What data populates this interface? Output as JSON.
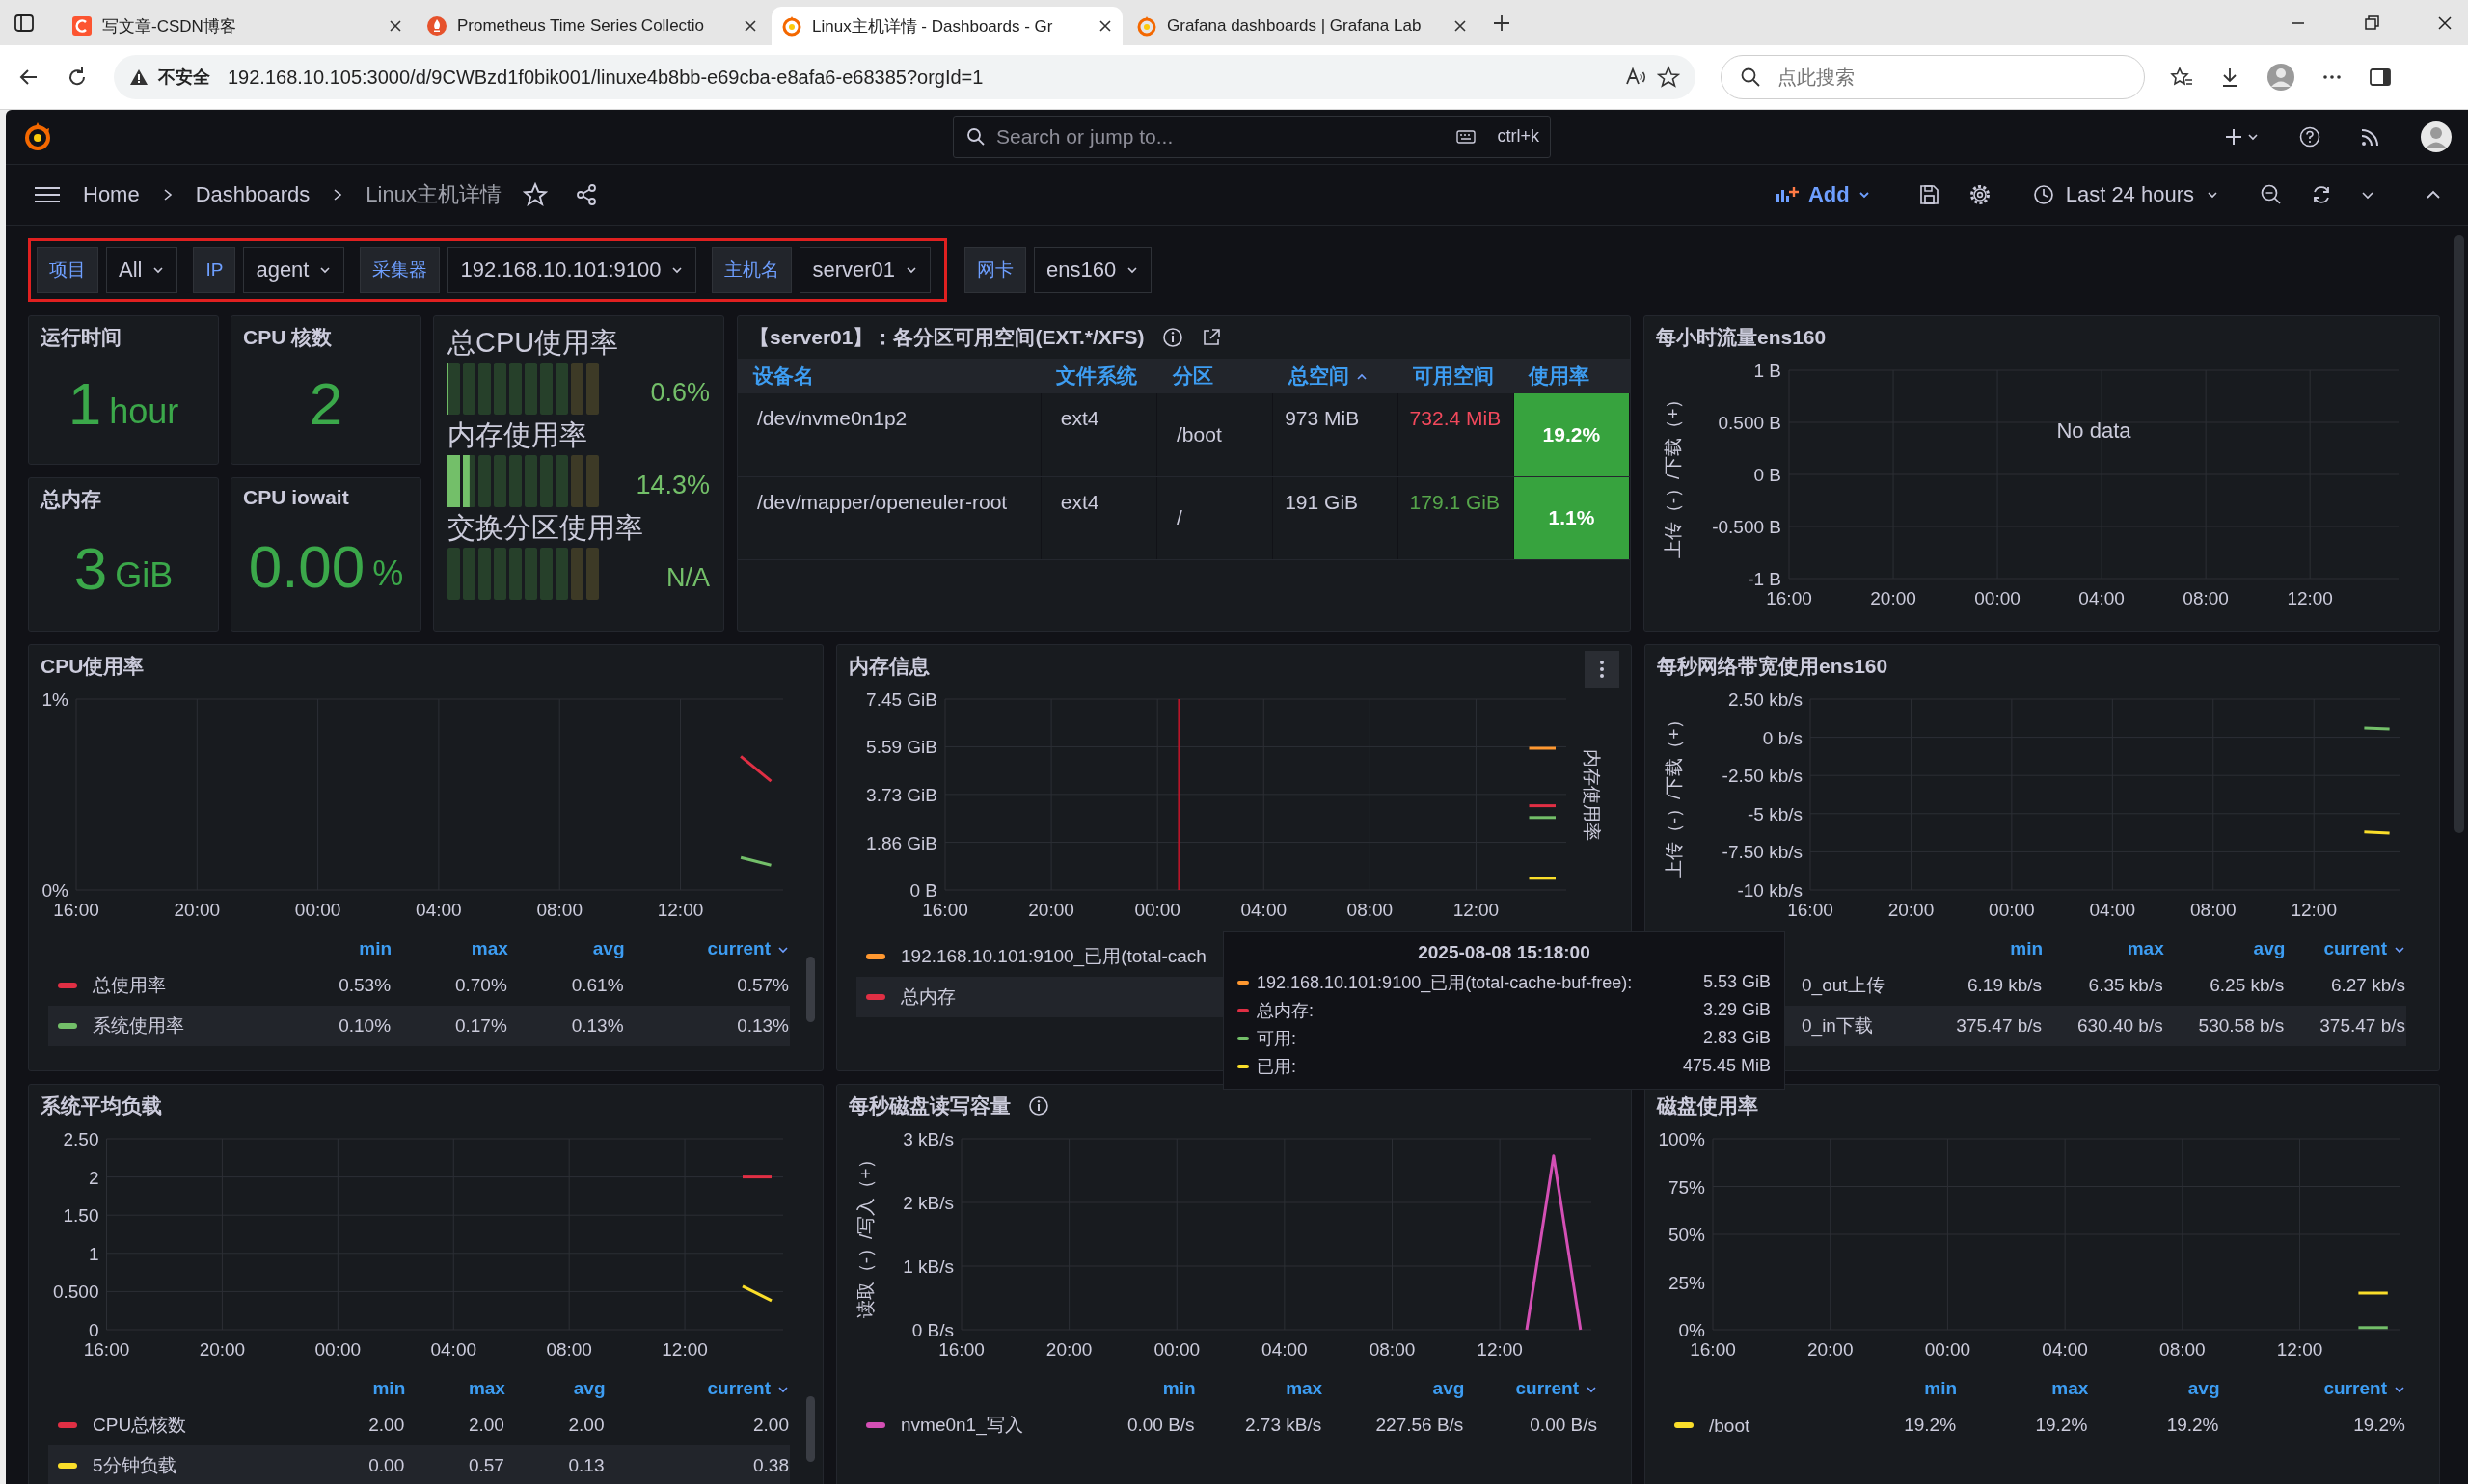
{
  "browser": {
    "tabs": [
      {
        "title": "写文章-CSDN博客",
        "selected": false
      },
      {
        "title": "Prometheus Time Series Collectio",
        "selected": false
      },
      {
        "title": "Linux主机详情 - Dashboards - Gr",
        "selected": true
      },
      {
        "title": "Grafana dashboards | Grafana Lab",
        "selected": false
      }
    ],
    "security": "不安全",
    "url": "192.168.10.105:3000/d/9CWBzd1f0bik001/linuxe4b8bb-e69cba-e8afa6-e68385?orgId=1",
    "search_placeholder": "点此搜索"
  },
  "grafana": {
    "search_placeholder": "Search or jump to...",
    "shortcut": "ctrl+k",
    "breadcrumbs": [
      "Home",
      "Dashboards",
      "Linux主机详情"
    ],
    "add_label": "Add",
    "time_range": "Last 24 hours"
  },
  "variable_groups": [
    {
      "highlighted": true,
      "items": [
        {
          "label": "项目",
          "value": "All"
        },
        {
          "label": "IP",
          "value": "agent"
        },
        {
          "label": "采集器",
          "value": "192.168.10.101:9100"
        },
        {
          "label": "主机名",
          "value": "server01"
        }
      ]
    },
    {
      "highlighted": false,
      "items": [
        {
          "label": "网卡",
          "value": "ens160"
        }
      ]
    }
  ],
  "stats": [
    {
      "title": "运行时间",
      "value": "1",
      "unit": "hour"
    },
    {
      "title": "CPU 核数",
      "value": "2"
    },
    {
      "title": "总内存",
      "value": "3",
      "unit": "GiB"
    },
    {
      "title": "CPU iowait",
      "value": "0.00",
      "unit": "%"
    }
  ],
  "gauges": [
    {
      "title": "总CPU使用率",
      "level": 0.006,
      "reading": "0.6%"
    },
    {
      "title": "内存使用率",
      "level": 0.143,
      "reading": "14.3%"
    },
    {
      "title": "交换分区使用率",
      "reading": "N/A"
    }
  ],
  "partition_table": {
    "title": "【server01】：各分区可用空间(EXT.*/XFS)",
    "columns": [
      {
        "label": "设备名",
        "sorted": false
      },
      {
        "label": "文件系统",
        "sorted": false
      },
      {
        "label": "分区",
        "sorted": false
      },
      {
        "label": "总空间",
        "sorted": true
      },
      {
        "label": "可用空间",
        "sorted": false
      },
      {
        "label": "使用率",
        "sorted": false
      }
    ],
    "rows": [
      {
        "device": "/dev/nvme0n1p2",
        "fs": "ext4",
        "mount": "/boot",
        "total": "973 MiB",
        "avail": "732.4 MiB",
        "color": "#f2495c",
        "usage": "19.2%"
      },
      {
        "device": "/dev/mapper/openeuler-root",
        "fs": "ext4",
        "mount": "/",
        "total": "191 GiB",
        "avail": "179.1 GiB",
        "color": "#56a64b",
        "usage": "1.1%"
      }
    ]
  },
  "chart_panels": [
    {
      "title": "每小时流量ens160",
      "no_data": "No data",
      "chart_data": {
        "type": "line",
        "grid": true,
        "ylabel": "上传（-）/下载（+）",
        "categories": [
          "16:00",
          null,
          null,
          null,
          "20:00",
          null,
          null,
          null,
          "00:00",
          null,
          null,
          null,
          "04:00",
          null,
          null,
          null,
          "08:00",
          null,
          null,
          null,
          "12:00",
          null,
          null,
          null
        ],
        "ylim": [
          -1,
          1
        ],
        "yticks": [
          {
            "value": 1,
            "label": "1 B"
          },
          {
            "value": 0.5,
            "label": "0.500 B"
          },
          {
            "value": 0,
            "label": "0 B"
          },
          {
            "value": -0.5,
            "label": "-0.500 B"
          },
          {
            "value": -1,
            "label": "-1 B"
          }
        ]
      }
    },
    {
      "title": "CPU使用率",
      "chart_data": {
        "type": "line",
        "grid": true,
        "categories": [
          "16:00",
          null,
          null,
          null,
          "20:00",
          null,
          null,
          null,
          "00:00",
          null,
          null,
          null,
          "04:00",
          null,
          null,
          null,
          "08:00",
          null,
          null,
          null,
          "12:00",
          null,
          null,
          null
        ],
        "ylim": [
          0,
          1
        ],
        "yticks": [
          {
            "value": 1,
            "label": "1%"
          },
          {
            "value": 0,
            "label": "0%"
          }
        ],
        "series": [
          {
            "color": "#e02f44",
            "values": [
              null,
              null,
              null,
              null,
              null,
              null,
              null,
              null,
              null,
              null,
              null,
              null,
              null,
              null,
              null,
              null,
              null,
              null,
              null,
              null,
              null,
              null,
              0.7,
              0.57
            ]
          },
          {
            "color": "#73bf69",
            "values": [
              null,
              null,
              null,
              null,
              null,
              null,
              null,
              null,
              null,
              null,
              null,
              null,
              null,
              null,
              null,
              null,
              null,
              null,
              null,
              null,
              null,
              null,
              0.17,
              0.13
            ]
          }
        ]
      },
      "legend": {
        "columns": [
          {
            "label": "min",
            "sorted": false
          },
          {
            "label": "max",
            "sorted": false
          },
          {
            "label": "avg",
            "sorted": false
          },
          {
            "label": "current",
            "sorted": true
          }
        ],
        "rows": [
          {
            "name": "总使用率",
            "color": "#e02f44",
            "values": [
              "0.53%",
              "0.70%",
              "0.61%",
              "0.57%"
            ]
          },
          {
            "name": "系统使用率",
            "color": "#73bf69",
            "values": [
              "0.10%",
              "0.17%",
              "0.13%",
              "0.13%"
            ]
          }
        ]
      }
    },
    {
      "title": "内存信息",
      "menu": true,
      "right_label": "内存使用率",
      "chart_data": {
        "type": "line",
        "grid": true,
        "categories": [
          "16:00",
          null,
          null,
          null,
          "20:00",
          null,
          null,
          null,
          "00:00",
          null,
          null,
          null,
          "04:00",
          null,
          null,
          null,
          "08:00",
          null,
          null,
          null,
          "12:00",
          null,
          null,
          null
        ],
        "ylim": [
          0,
          7.45
        ],
        "yticks": [
          {
            "value": 7.45,
            "label": "7.45 GiB"
          },
          {
            "value": 5.59,
            "label": "5.59 GiB"
          },
          {
            "value": 3.73,
            "label": "3.73 GiB"
          },
          {
            "value": 1.86,
            "label": "1.86 GiB"
          },
          {
            "value": 0,
            "label": "0 B"
          }
        ],
        "series": [
          {
            "color": "#ff9830",
            "values": [
              null,
              null,
              null,
              null,
              null,
              null,
              null,
              null,
              null,
              null,
              null,
              null,
              null,
              null,
              null,
              null,
              null,
              null,
              null,
              null,
              null,
              null,
              5.53,
              5.53
            ]
          },
          {
            "color": "#e02f44",
            "values": [
              null,
              null,
              null,
              null,
              null,
              null,
              null,
              null,
              null,
              null,
              null,
              null,
              null,
              null,
              null,
              null,
              null,
              null,
              null,
              null,
              null,
              null,
              3.29,
              3.29
            ]
          },
          {
            "color": "#73bf69",
            "values": [
              null,
              null,
              null,
              null,
              null,
              null,
              null,
              null,
              null,
              null,
              null,
              null,
              null,
              null,
              null,
              null,
              null,
              null,
              null,
              null,
              null,
              null,
              2.83,
              2.83
            ]
          },
          {
            "color": "#fade2a",
            "values": [
              null,
              null,
              null,
              null,
              null,
              null,
              null,
              null,
              null,
              null,
              null,
              null,
              null,
              null,
              null,
              null,
              null,
              null,
              null,
              null,
              null,
              null,
              0.46,
              0.46
            ]
          }
        ]
      },
      "legend": {
        "rows": [
          {
            "name": "192.168.10.101:9100_已用(total-cach",
            "color": "#ff9830"
          },
          {
            "name": "总内存",
            "color": "#e02f44"
          }
        ]
      },
      "tooltip": {
        "time": "2025-08-08 15:18:00",
        "rows": [
          {
            "label": "192.168.10.101:9100_已用(total-cache-buf-free):",
            "value": "5.53 GiB",
            "color": "#ff9830"
          },
          {
            "label": "总内存:",
            "value": "3.29 GiB",
            "color": "#e02f44"
          },
          {
            "label": "可用:",
            "value": "2.83 GiB",
            "color": "#73bf69"
          },
          {
            "label": "已用:",
            "value": "475.45 MiB",
            "color": "#fade2a"
          }
        ]
      }
    },
    {
      "title": "每秒网络带宽使用ens160",
      "chart_data": {
        "type": "line",
        "grid": true,
        "ylabel": "上传（-）/下载（+）",
        "categories": [
          "16:00",
          null,
          null,
          null,
          "20:00",
          null,
          null,
          null,
          "00:00",
          null,
          null,
          null,
          "04:00",
          null,
          null,
          null,
          "08:00",
          null,
          null,
          null,
          "12:00",
          null,
          null,
          null
        ],
        "ylim": [
          -10,
          2.5
        ],
        "yticks": [
          {
            "value": 2.5,
            "label": "2.50 kb/s"
          },
          {
            "value": 0,
            "label": "0 b/s"
          },
          {
            "value": -2.5,
            "label": "-2.50 kb/s"
          },
          {
            "value": -5,
            "label": "-5 kb/s"
          },
          {
            "value": -7.5,
            "label": "-7.50 kb/s"
          },
          {
            "value": -10,
            "label": "-10 kb/s"
          }
        ],
        "series": [
          {
            "color": "#73bf69",
            "values": [
              null,
              null,
              null,
              null,
              null,
              null,
              null,
              null,
              null,
              null,
              null,
              null,
              null,
              null,
              null,
              null,
              null,
              null,
              null,
              null,
              null,
              null,
              0.6,
              0.55
            ]
          },
          {
            "color": "#fade2a",
            "values": [
              null,
              null,
              null,
              null,
              null,
              null,
              null,
              null,
              null,
              null,
              null,
              null,
              null,
              null,
              null,
              null,
              null,
              null,
              null,
              null,
              null,
              null,
              -6.2,
              -6.27
            ]
          }
        ]
      },
      "legend": {
        "columns": [
          {
            "label": "min",
            "sorted": false
          },
          {
            "label": "max",
            "sorted": false
          },
          {
            "label": "avg",
            "sorted": false
          },
          {
            "label": "current",
            "sorted": true
          }
        ],
        "rows": [
          {
            "name": "0_out上传",
            "values": [
              "6.19 kb/s",
              "6.35 kb/s",
              "6.25 kb/s",
              "6.27 kb/s"
            ]
          },
          {
            "name": "0_in下载",
            "values": [
              "375.47 b/s",
              "630.40 b/s",
              "530.58 b/s",
              "375.47 b/s"
            ]
          }
        ]
      }
    },
    {
      "title": "系统平均负载",
      "chart_data": {
        "type": "line",
        "grid": true,
        "categories": [
          "16:00",
          null,
          null,
          null,
          "20:00",
          null,
          null,
          null,
          "00:00",
          null,
          null,
          null,
          "04:00",
          null,
          null,
          null,
          "08:00",
          null,
          null,
          null,
          "12:00",
          null,
          null,
          null
        ],
        "ylim": [
          0,
          2.5
        ],
        "yticks": [
          {
            "value": 2.5,
            "label": "2.50"
          },
          {
            "value": 2,
            "label": "2"
          },
          {
            "value": 1.5,
            "label": "1.50"
          },
          {
            "value": 1,
            "label": "1"
          },
          {
            "value": 0.5,
            "label": "0.500"
          },
          {
            "value": 0,
            "label": "0"
          }
        ],
        "series": [
          {
            "color": "#e02f44",
            "values": [
              null,
              null,
              null,
              null,
              null,
              null,
              null,
              null,
              null,
              null,
              null,
              null,
              null,
              null,
              null,
              null,
              null,
              null,
              null,
              null,
              null,
              null,
              2,
              2
            ]
          },
          {
            "color": "#fade2a",
            "values": [
              null,
              null,
              null,
              null,
              null,
              null,
              null,
              null,
              null,
              null,
              null,
              null,
              null,
              null,
              null,
              null,
              null,
              null,
              null,
              null,
              null,
              null,
              0.57,
              0.38
            ]
          }
        ]
      },
      "legend": {
        "columns": [
          {
            "label": "min",
            "sorted": false
          },
          {
            "label": "max",
            "sorted": false
          },
          {
            "label": "avg",
            "sorted": false
          },
          {
            "label": "current",
            "sorted": true
          }
        ],
        "rows": [
          {
            "name": "CPU总核数",
            "color": "#e02f44",
            "values": [
              "2.00",
              "2.00",
              "2.00",
              "2.00"
            ]
          },
          {
            "name": "5分钟负载",
            "color": "#fade2a",
            "values": [
              "0.00",
              "0.57",
              "0.13",
              "0.38"
            ]
          }
        ]
      }
    },
    {
      "title": "每秒磁盘读写容量",
      "info": true,
      "chart_data": {
        "type": "line",
        "grid": true,
        "ylabel": "读取（-）/写入（+）",
        "categories": [
          "16:00",
          null,
          null,
          null,
          "20:00",
          null,
          null,
          null,
          "00:00",
          null,
          null,
          null,
          "04:00",
          null,
          null,
          null,
          "08:00",
          null,
          null,
          null,
          "12:00",
          null,
          null,
          null
        ],
        "ylim": [
          0,
          3
        ],
        "yticks": [
          {
            "value": 3,
            "label": "3 kB/s"
          },
          {
            "value": 2,
            "label": "2 kB/s"
          },
          {
            "value": 1,
            "label": "1 kB/s"
          },
          {
            "value": 0,
            "label": "0 B/s"
          }
        ],
        "series": [
          {
            "color": "#d44fb5",
            "values": [
              null,
              null,
              null,
              null,
              null,
              null,
              null,
              null,
              null,
              null,
              null,
              null,
              null,
              null,
              null,
              null,
              null,
              null,
              null,
              null,
              null,
              0,
              2.73,
              0
            ]
          }
        ]
      },
      "legend": {
        "columns": [
          {
            "label": "min",
            "sorted": false
          },
          {
            "label": "max",
            "sorted": false
          },
          {
            "label": "avg",
            "sorted": false
          },
          {
            "label": "current",
            "sorted": true
          }
        ],
        "rows": [
          {
            "name": "nvme0n1_写入",
            "color": "#d44fb5",
            "values": [
              "0.00 B/s",
              "2.73 kB/s",
              "227.56 B/s",
              "0.00 B/s"
            ]
          }
        ]
      }
    },
    {
      "title": "磁盘使用率",
      "chart_data": {
        "type": "line",
        "grid": true,
        "categories": [
          "16:00",
          null,
          null,
          null,
          "20:00",
          null,
          null,
          null,
          "00:00",
          null,
          null,
          null,
          "04:00",
          null,
          null,
          null,
          "08:00",
          null,
          null,
          null,
          "12:00",
          null,
          null,
          null
        ],
        "ylim": [
          0,
          100
        ],
        "yticks": [
          {
            "value": 100,
            "label": "100%"
          },
          {
            "value": 75,
            "label": "75%"
          },
          {
            "value": 50,
            "label": "50%"
          },
          {
            "value": 25,
            "label": "25%"
          },
          {
            "value": 0,
            "label": "0%"
          }
        ],
        "series": [
          {
            "color": "#fade2a",
            "values": [
              null,
              null,
              null,
              null,
              null,
              null,
              null,
              null,
              null,
              null,
              null,
              null,
              null,
              null,
              null,
              null,
              null,
              null,
              null,
              null,
              null,
              null,
              19.2,
              19.2
            ]
          },
          {
            "color": "#73bf69",
            "values": [
              null,
              null,
              null,
              null,
              null,
              null,
              null,
              null,
              null,
              null,
              null,
              null,
              null,
              null,
              null,
              null,
              null,
              null,
              null,
              null,
              null,
              null,
              1.1,
              1.1
            ]
          }
        ]
      },
      "legend": {
        "columns": [
          {
            "label": "min",
            "sorted": false
          },
          {
            "label": "max",
            "sorted": false
          },
          {
            "label": "avg",
            "sorted": false
          },
          {
            "label": "current",
            "sorted": true
          }
        ],
        "rows": [
          {
            "name": "/boot",
            "color": "#fade2a",
            "values": [
              "19.2%",
              "19.2%",
              "19.2%",
              "19.2%"
            ]
          }
        ]
      }
    }
  ]
}
